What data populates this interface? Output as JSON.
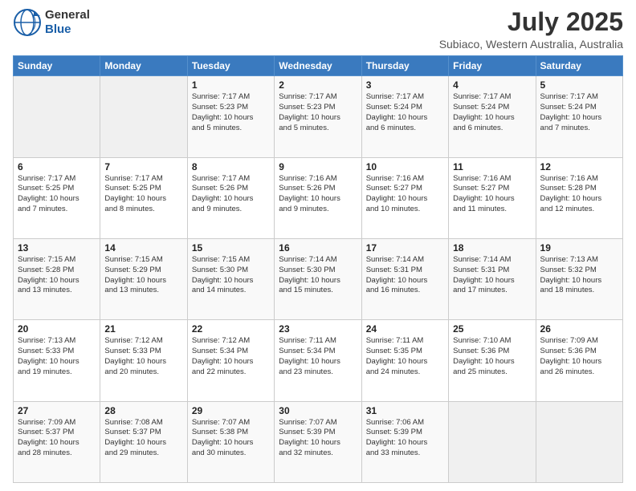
{
  "logo": {
    "line1": "General",
    "line2": "Blue"
  },
  "header": {
    "title": "July 2025",
    "subtitle": "Subiaco, Western Australia, Australia"
  },
  "weekdays": [
    "Sunday",
    "Monday",
    "Tuesday",
    "Wednesday",
    "Thursday",
    "Friday",
    "Saturday"
  ],
  "weeks": [
    [
      {
        "day": "",
        "info": ""
      },
      {
        "day": "",
        "info": ""
      },
      {
        "day": "1",
        "info": "Sunrise: 7:17 AM\nSunset: 5:23 PM\nDaylight: 10 hours\nand 5 minutes."
      },
      {
        "day": "2",
        "info": "Sunrise: 7:17 AM\nSunset: 5:23 PM\nDaylight: 10 hours\nand 5 minutes."
      },
      {
        "day": "3",
        "info": "Sunrise: 7:17 AM\nSunset: 5:24 PM\nDaylight: 10 hours\nand 6 minutes."
      },
      {
        "day": "4",
        "info": "Sunrise: 7:17 AM\nSunset: 5:24 PM\nDaylight: 10 hours\nand 6 minutes."
      },
      {
        "day": "5",
        "info": "Sunrise: 7:17 AM\nSunset: 5:24 PM\nDaylight: 10 hours\nand 7 minutes."
      }
    ],
    [
      {
        "day": "6",
        "info": "Sunrise: 7:17 AM\nSunset: 5:25 PM\nDaylight: 10 hours\nand 7 minutes."
      },
      {
        "day": "7",
        "info": "Sunrise: 7:17 AM\nSunset: 5:25 PM\nDaylight: 10 hours\nand 8 minutes."
      },
      {
        "day": "8",
        "info": "Sunrise: 7:17 AM\nSunset: 5:26 PM\nDaylight: 10 hours\nand 9 minutes."
      },
      {
        "day": "9",
        "info": "Sunrise: 7:16 AM\nSunset: 5:26 PM\nDaylight: 10 hours\nand 9 minutes."
      },
      {
        "day": "10",
        "info": "Sunrise: 7:16 AM\nSunset: 5:27 PM\nDaylight: 10 hours\nand 10 minutes."
      },
      {
        "day": "11",
        "info": "Sunrise: 7:16 AM\nSunset: 5:27 PM\nDaylight: 10 hours\nand 11 minutes."
      },
      {
        "day": "12",
        "info": "Sunrise: 7:16 AM\nSunset: 5:28 PM\nDaylight: 10 hours\nand 12 minutes."
      }
    ],
    [
      {
        "day": "13",
        "info": "Sunrise: 7:15 AM\nSunset: 5:28 PM\nDaylight: 10 hours\nand 13 minutes."
      },
      {
        "day": "14",
        "info": "Sunrise: 7:15 AM\nSunset: 5:29 PM\nDaylight: 10 hours\nand 13 minutes."
      },
      {
        "day": "15",
        "info": "Sunrise: 7:15 AM\nSunset: 5:30 PM\nDaylight: 10 hours\nand 14 minutes."
      },
      {
        "day": "16",
        "info": "Sunrise: 7:14 AM\nSunset: 5:30 PM\nDaylight: 10 hours\nand 15 minutes."
      },
      {
        "day": "17",
        "info": "Sunrise: 7:14 AM\nSunset: 5:31 PM\nDaylight: 10 hours\nand 16 minutes."
      },
      {
        "day": "18",
        "info": "Sunrise: 7:14 AM\nSunset: 5:31 PM\nDaylight: 10 hours\nand 17 minutes."
      },
      {
        "day": "19",
        "info": "Sunrise: 7:13 AM\nSunset: 5:32 PM\nDaylight: 10 hours\nand 18 minutes."
      }
    ],
    [
      {
        "day": "20",
        "info": "Sunrise: 7:13 AM\nSunset: 5:33 PM\nDaylight: 10 hours\nand 19 minutes."
      },
      {
        "day": "21",
        "info": "Sunrise: 7:12 AM\nSunset: 5:33 PM\nDaylight: 10 hours\nand 20 minutes."
      },
      {
        "day": "22",
        "info": "Sunrise: 7:12 AM\nSunset: 5:34 PM\nDaylight: 10 hours\nand 22 minutes."
      },
      {
        "day": "23",
        "info": "Sunrise: 7:11 AM\nSunset: 5:34 PM\nDaylight: 10 hours\nand 23 minutes."
      },
      {
        "day": "24",
        "info": "Sunrise: 7:11 AM\nSunset: 5:35 PM\nDaylight: 10 hours\nand 24 minutes."
      },
      {
        "day": "25",
        "info": "Sunrise: 7:10 AM\nSunset: 5:36 PM\nDaylight: 10 hours\nand 25 minutes."
      },
      {
        "day": "26",
        "info": "Sunrise: 7:09 AM\nSunset: 5:36 PM\nDaylight: 10 hours\nand 26 minutes."
      }
    ],
    [
      {
        "day": "27",
        "info": "Sunrise: 7:09 AM\nSunset: 5:37 PM\nDaylight: 10 hours\nand 28 minutes."
      },
      {
        "day": "28",
        "info": "Sunrise: 7:08 AM\nSunset: 5:37 PM\nDaylight: 10 hours\nand 29 minutes."
      },
      {
        "day": "29",
        "info": "Sunrise: 7:07 AM\nSunset: 5:38 PM\nDaylight: 10 hours\nand 30 minutes."
      },
      {
        "day": "30",
        "info": "Sunrise: 7:07 AM\nSunset: 5:39 PM\nDaylight: 10 hours\nand 32 minutes."
      },
      {
        "day": "31",
        "info": "Sunrise: 7:06 AM\nSunset: 5:39 PM\nDaylight: 10 hours\nand 33 minutes."
      },
      {
        "day": "",
        "info": ""
      },
      {
        "day": "",
        "info": ""
      }
    ]
  ]
}
